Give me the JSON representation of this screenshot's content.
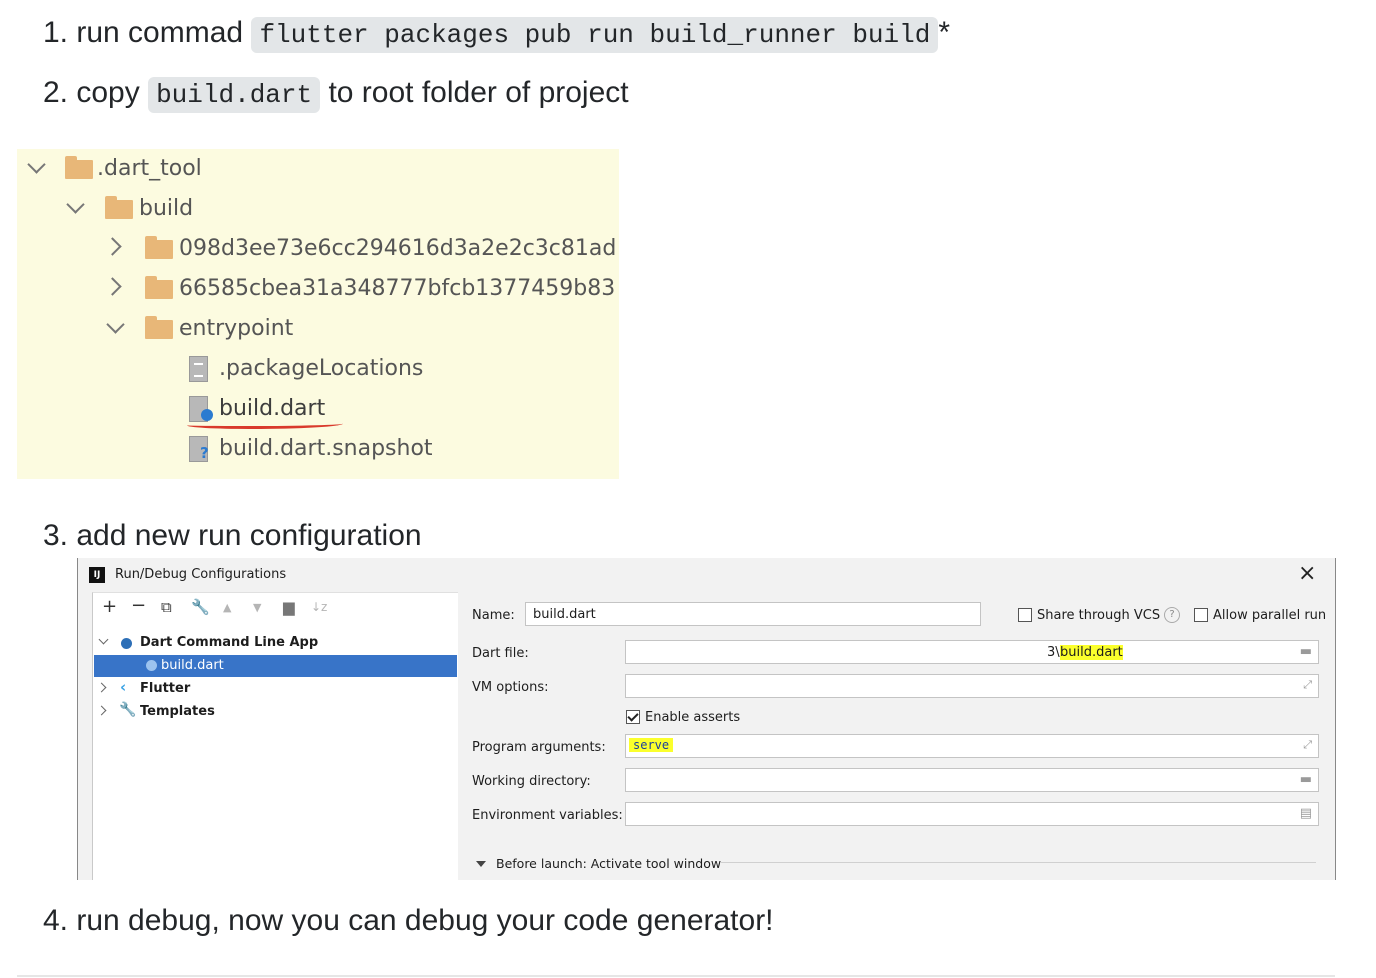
{
  "steps": {
    "s1": {
      "prefix": "1. run commad",
      "code": "flutter packages pub run build_runner build",
      "suffix": "*"
    },
    "s2": {
      "prefix": "2. copy",
      "code": "build.dart",
      "suffix": "to root folder of project"
    },
    "s3": {
      "text": "3. add new run configuration"
    },
    "s4": {
      "text": "4. run debug, now you can debug your code generator!"
    }
  },
  "project_tree": {
    "items": [
      {
        "label": ".dart_tool",
        "type": "folder",
        "expanded": true
      },
      {
        "label": "build",
        "type": "folder",
        "expanded": true
      },
      {
        "label": "098d3ee73e6cc294616d3a2e2c3c81ad",
        "type": "folder",
        "expanded": false
      },
      {
        "label": "66585cbea31a348777bfcb1377459b83",
        "type": "folder",
        "expanded": false
      },
      {
        "label": "entrypoint",
        "type": "folder",
        "expanded": true
      },
      {
        "label": ".packageLocations",
        "type": "file"
      },
      {
        "label": "build.dart",
        "type": "dart-file",
        "underlined": true
      },
      {
        "label": "build.dart.snapshot",
        "type": "unknown-file"
      }
    ],
    "colors": {
      "background": "#fcfbe0",
      "folder": "#e8b778",
      "underline": "#d93a2c"
    }
  },
  "dialog": {
    "title": "Run/Debug Configurations",
    "toolbar_icons": [
      "add-icon",
      "remove-icon",
      "copy-icon",
      "wrench-icon",
      "move-up-icon",
      "move-down-icon",
      "folder-icon",
      "sort-icon"
    ],
    "tree": [
      {
        "label": "Dart Command Line App",
        "bold": true,
        "expanded": true
      },
      {
        "label": "build.dart",
        "selected": true
      },
      {
        "label": "Flutter",
        "bold": true,
        "expanded": false
      },
      {
        "label": "Templates",
        "bold": true,
        "expanded": false
      }
    ],
    "name_label": "Name:",
    "name_value": "build.dart",
    "share_vcs_label": "Share through VCS",
    "share_vcs_checked": false,
    "allow_parallel_label": "Allow parallel run",
    "allow_parallel_checked": false,
    "dart_file_label": "Dart file:",
    "dart_file_prefix": "3\\",
    "dart_file_value": "build.dart",
    "vm_options_label": "VM options:",
    "vm_options_value": "",
    "enable_asserts_label": "Enable asserts",
    "enable_asserts_checked": true,
    "program_args_label": "Program arguments:",
    "program_args_value": "serve",
    "working_dir_label": "Working directory:",
    "working_dir_value": "",
    "env_vars_label": "Environment variables:",
    "env_vars_value": "",
    "before_launch_label": "Before launch: Activate tool window",
    "colors": {
      "selection": "#3874c8",
      "highlight": "#fbff2c"
    }
  }
}
